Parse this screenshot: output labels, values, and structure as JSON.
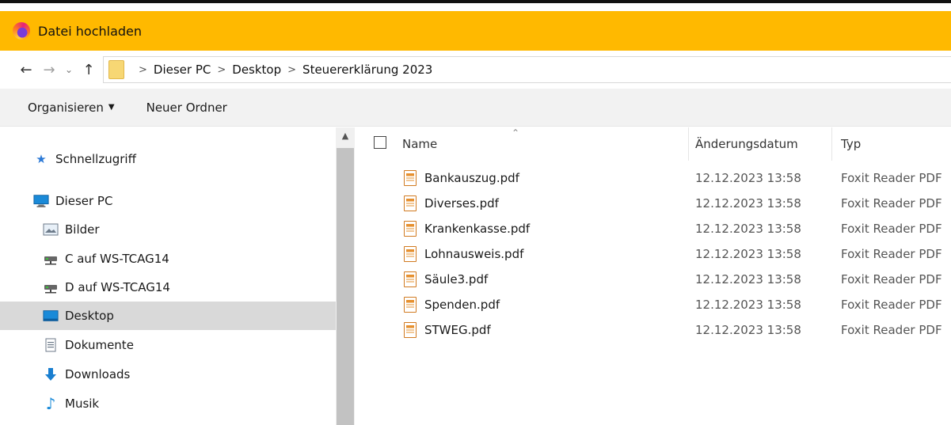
{
  "window": {
    "title": "Datei hochladen"
  },
  "address": {
    "breadcrumbs": [
      "Dieser PC",
      "Desktop",
      "Steuererklärung 2023"
    ],
    "separator": ">"
  },
  "toolbar": {
    "organize_label": "Organisieren",
    "new_folder_label": "Neuer Ordner"
  },
  "sidebar": {
    "items": [
      {
        "label": "Schnellzugriff",
        "icon": "star-icon"
      },
      {
        "label": "Dieser PC",
        "icon": "computer-icon"
      },
      {
        "label": "Bilder",
        "icon": "pictures-icon"
      },
      {
        "label": "C auf WS-TCAG14",
        "icon": "network-drive-icon"
      },
      {
        "label": "D auf WS-TCAG14",
        "icon": "network-drive-icon"
      },
      {
        "label": "Desktop",
        "icon": "desktop-icon",
        "selected": true
      },
      {
        "label": "Dokumente",
        "icon": "documents-icon"
      },
      {
        "label": "Downloads",
        "icon": "downloads-icon"
      },
      {
        "label": "Musik",
        "icon": "music-icon"
      }
    ]
  },
  "table": {
    "columns": [
      "Name",
      "Änderungsdatum",
      "Typ"
    ],
    "rows": [
      {
        "name": "Bankauszug.pdf",
        "date": "12.12.2023 13:58",
        "type": "Foxit Reader PDF"
      },
      {
        "name": "Diverses.pdf",
        "date": "12.12.2023 13:58",
        "type": "Foxit Reader PDF"
      },
      {
        "name": "Krankenkasse.pdf",
        "date": "12.12.2023 13:58",
        "type": "Foxit Reader PDF"
      },
      {
        "name": "Lohnausweis.pdf",
        "date": "12.12.2023 13:58",
        "type": "Foxit Reader PDF"
      },
      {
        "name": "Säule3.pdf",
        "date": "12.12.2023 13:58",
        "type": "Foxit Reader PDF"
      },
      {
        "name": "Spenden.pdf",
        "date": "12.12.2023 13:58",
        "type": "Foxit Reader PDF"
      },
      {
        "name": "STWEG.pdf",
        "date": "12.12.2023 13:58",
        "type": "Foxit Reader PDF"
      }
    ]
  },
  "colors": {
    "titlebar": "#ffb900",
    "selected": "#d9d9d9",
    "accent": "#0078d7"
  }
}
